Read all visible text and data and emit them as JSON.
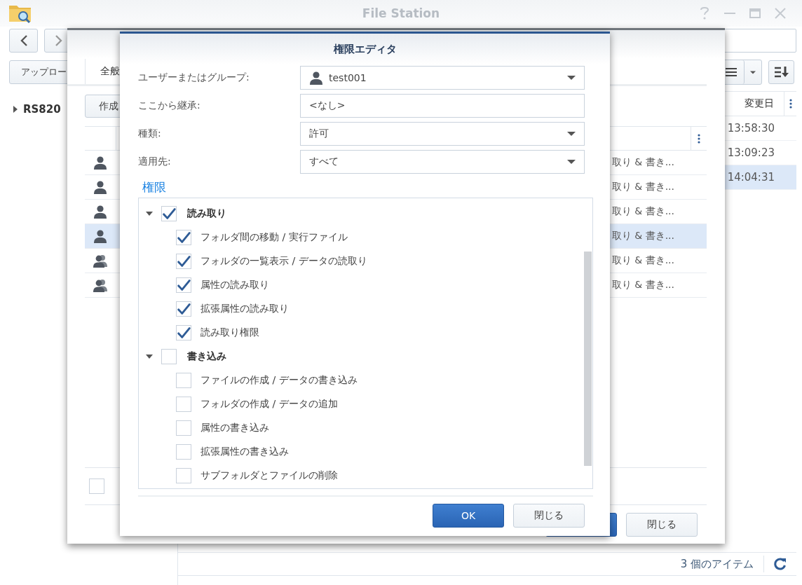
{
  "window": {
    "title": "File Station"
  },
  "toolbar": {
    "upload_button": "アップロー"
  },
  "tree": [
    {
      "label": "RS820",
      "expanded": false
    }
  ],
  "file_list": {
    "columns": [
      "変更日"
    ],
    "rows": [
      {
        "modified": "13:58:30",
        "selected": false
      },
      {
        "modified": "13:09:23",
        "selected": false
      },
      {
        "modified": "14:04:31",
        "selected": true
      }
    ]
  },
  "status_bar": {
    "item_count": "3 個のアイテム"
  },
  "properties_dialog": {
    "tabs": [
      {
        "label": "全般",
        "selected": true
      }
    ],
    "create_button": "作成",
    "permissions": [
      {
        "kind": "user",
        "permission": "取り & 書き...",
        "selected": false
      },
      {
        "kind": "user",
        "permission": "取り & 書き...",
        "selected": false
      },
      {
        "kind": "user",
        "permission": "取り & 書き...",
        "selected": false
      },
      {
        "kind": "user",
        "permission": "取り & 書き...",
        "selected": true
      },
      {
        "kind": "group",
        "permission": "取り & 書き...",
        "selected": false
      },
      {
        "kind": "group",
        "permission": "取り & 書き...",
        "selected": false
      }
    ],
    "apply_checkbox": {
      "checked": false
    },
    "buttons": [
      {
        "kind": "primary"
      },
      {
        "kind": "secondary",
        "label": "閉じる"
      }
    ]
  },
  "permission_editor": {
    "title": "権限エディタ",
    "fields": [
      {
        "kind": "user_select",
        "label": "ユーザーまたはグループ:",
        "value": "test001"
      },
      {
        "kind": "text",
        "label": "ここから継承:",
        "value": "<なし>"
      },
      {
        "kind": "select",
        "label": "種類:",
        "value": "許可"
      },
      {
        "kind": "select",
        "label": "適用先:",
        "value": "すべて"
      }
    ],
    "section_title": "権限",
    "permissions": [
      {
        "label": "読み取り",
        "checked": true,
        "expanded": true,
        "children": [
          {
            "label": "フォルダ間の移動 / 実行ファイル",
            "checked": true
          },
          {
            "label": "フォルダの一覧表示 / データの読取り",
            "checked": true
          },
          {
            "label": "属性の読み取り",
            "checked": true
          },
          {
            "label": "拡張属性の読み取り",
            "checked": true
          },
          {
            "label": "読み取り権限",
            "checked": true
          }
        ]
      },
      {
        "label": "書き込み",
        "checked": false,
        "expanded": true,
        "children": [
          {
            "label": "ファイルの作成 / データの書き込み",
            "checked": false
          },
          {
            "label": "フォルダの作成 / データの追加",
            "checked": false
          },
          {
            "label": "属性の書き込み",
            "checked": false
          },
          {
            "label": "拡張属性の書き込み",
            "checked": false
          },
          {
            "label": "サブフォルダとファイルの削除",
            "checked": false
          }
        ]
      }
    ],
    "buttons": [
      {
        "kind": "primary",
        "label": "OK"
      },
      {
        "kind": "secondary",
        "label": "閉じる"
      }
    ]
  }
}
